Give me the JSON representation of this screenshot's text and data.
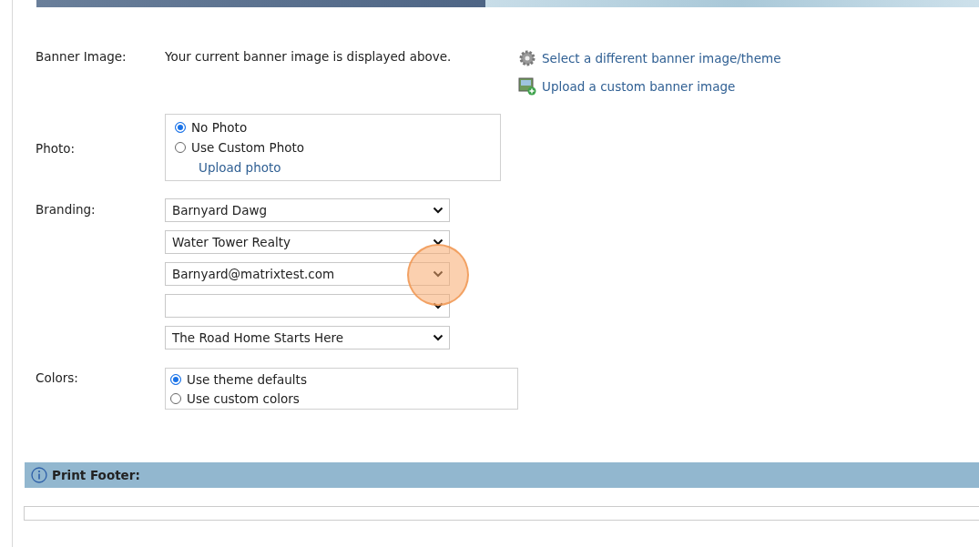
{
  "banner": {
    "label": "Banner Image:",
    "description": "Your current banner image is displayed above.",
    "links": [
      {
        "kind": "gear",
        "text": "Select a different banner image/theme"
      },
      {
        "kind": "upload",
        "text": "Upload a custom banner image"
      }
    ]
  },
  "photo": {
    "label": "Photo:",
    "options": [
      {
        "label": "No Photo",
        "selected": true
      },
      {
        "label": "Use Custom Photo",
        "selected": false
      }
    ],
    "link": "Upload photo"
  },
  "branding": {
    "label": "Branding:",
    "selects": [
      {
        "kind": "dropdown",
        "value": "Barnyard Dawg"
      },
      {
        "kind": "dropdown",
        "value": "Water Tower Realty"
      },
      {
        "kind": "dropdown",
        "value": "Barnyard@matrixtest.com"
      },
      {
        "kind": "dropdown"
      },
      {
        "kind": "dropdown",
        "value": "The Road Home Starts Here"
      }
    ]
  },
  "colors": {
    "label": "Colors:",
    "options": [
      {
        "label": "Use theme defaults",
        "selected": true
      },
      {
        "label": "Use custom colors",
        "selected": false
      }
    ]
  },
  "print_footer": {
    "title": "Print Footer:"
  }
}
